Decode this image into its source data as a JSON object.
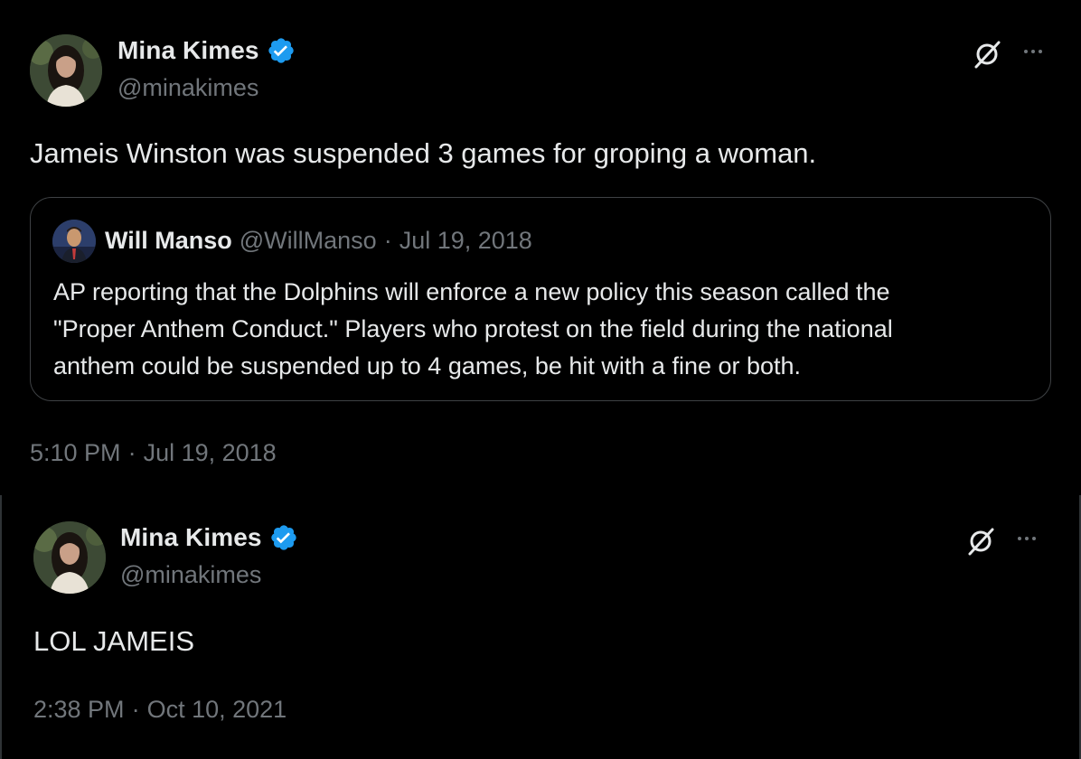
{
  "tweets": [
    {
      "author": {
        "name": "Mina Kimes",
        "handle": "@minakimes"
      },
      "text": "Jameis Winston was suspended 3 games for groping a woman.",
      "quote": {
        "author": {
          "name": "Will Manso",
          "handle": "@WillManso"
        },
        "separator": "·",
        "date": "Jul 19, 2018",
        "lines": [
          "AP reporting that the Dolphins will enforce a new policy this season called the",
          "\"Proper Anthem Conduct.\"  Players who protest on the field during the national",
          "anthem could be suspended up to 4 games, be hit with a fine or both."
        ]
      },
      "time": "5:10 PM",
      "separator": "·",
      "date": "Jul 19, 2018"
    },
    {
      "author": {
        "name": "Mina Kimes",
        "handle": "@minakimes"
      },
      "text": "LOL JAMEIS",
      "time": "2:38 PM",
      "separator": "·",
      "date": "Oct 10, 2021"
    }
  ],
  "colors": {
    "background": "#000000",
    "text_primary": "#e7e9ea",
    "text_secondary": "#71767b",
    "verified_blue": "#1d9bf0",
    "border": "#3e4144"
  },
  "icons": [
    "verified-badge-icon",
    "grok-icon",
    "more-options-icon"
  ]
}
